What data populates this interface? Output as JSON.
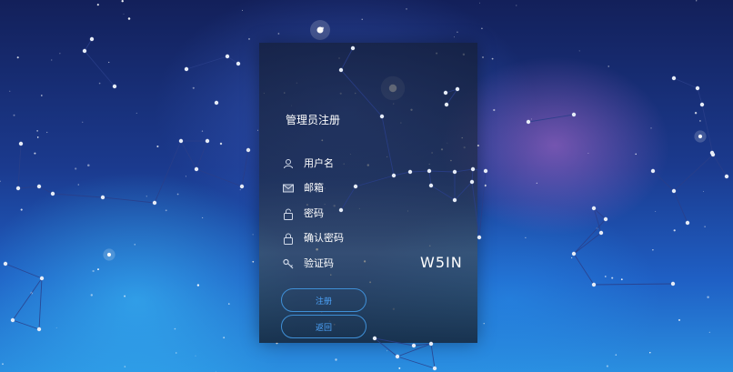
{
  "form": {
    "title": "管理员注册",
    "fields": [
      {
        "icon": "user-icon",
        "placeholder": "用户名"
      },
      {
        "icon": "mail-icon",
        "placeholder": "邮箱"
      },
      {
        "icon": "lock-icon",
        "placeholder": "密码"
      },
      {
        "icon": "lock-icon",
        "placeholder": "确认密码"
      },
      {
        "icon": "key-icon",
        "placeholder": "验证码"
      }
    ],
    "captcha_text": "W5IN",
    "register_label": "注册",
    "back_label": "返回"
  },
  "colors": {
    "button_border": "#3f8fd6",
    "button_text": "#4da6ff",
    "text": "#ffffff"
  }
}
